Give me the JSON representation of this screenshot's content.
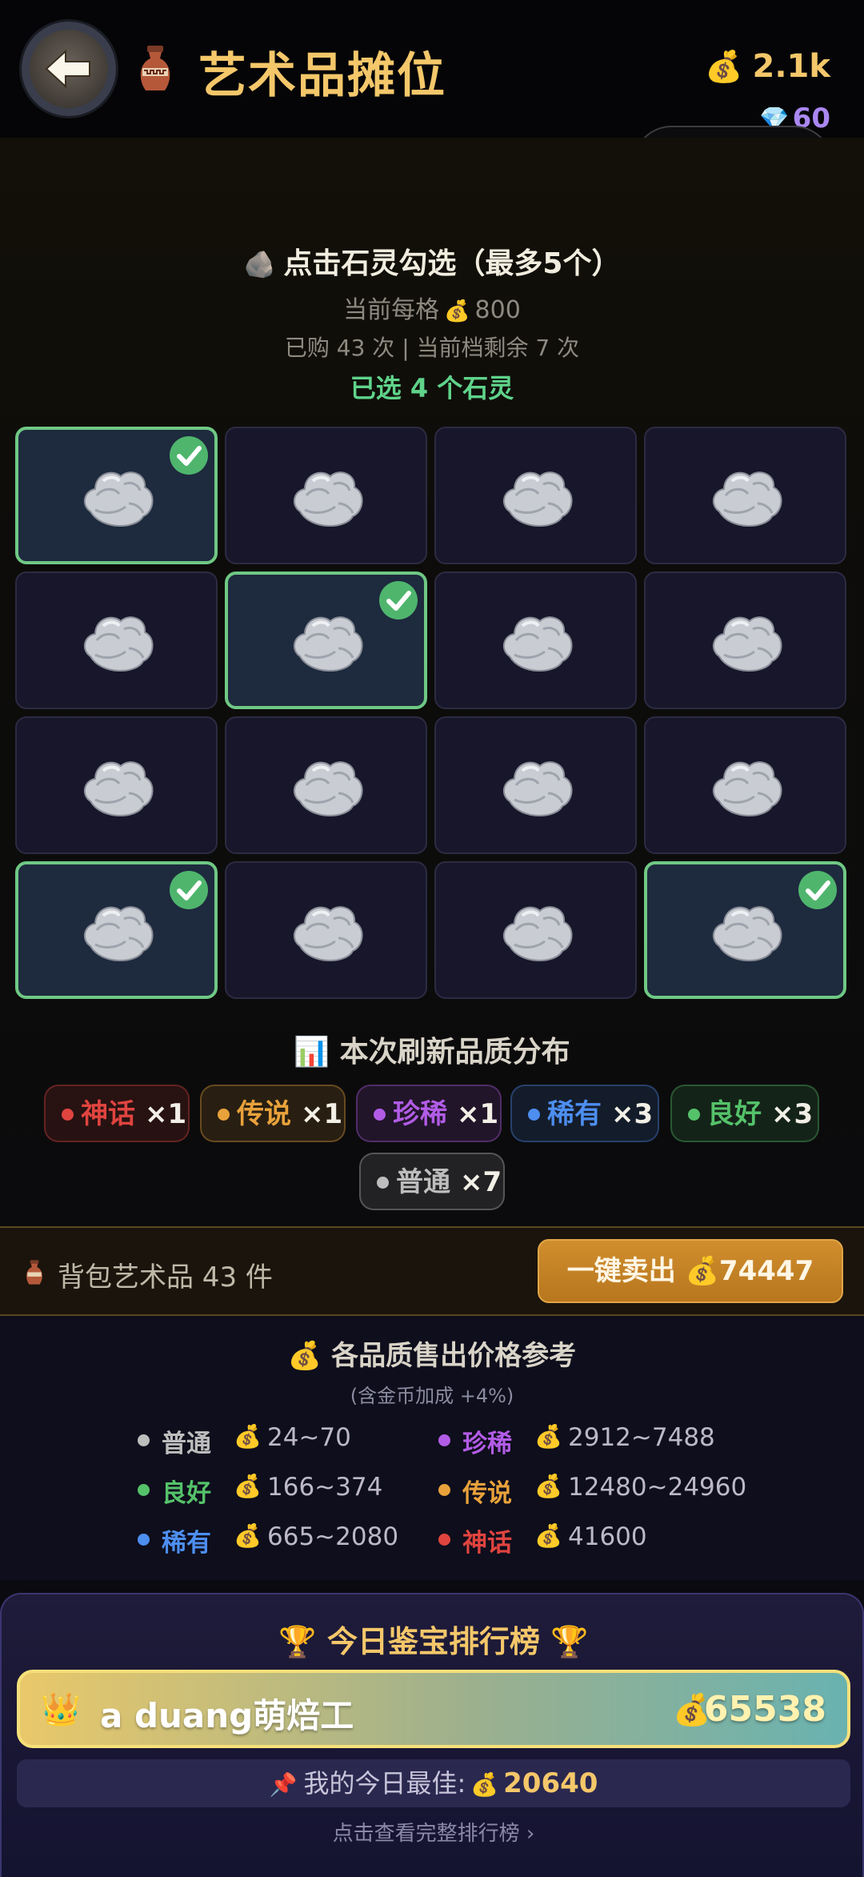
{
  "header": {
    "title": "艺术品摊位",
    "coins": "2.1k",
    "gems": "60"
  },
  "selection": {
    "instruction": "点击石灵勾选（最多5个）",
    "price_prefix": "当前每格",
    "price": "800",
    "purchase_info": "已购 43 次 | 当前档剩余 7 次",
    "selected_text": "已选 4 个石灵"
  },
  "grid": [
    {
      "selected": true
    },
    {
      "selected": false
    },
    {
      "selected": false
    },
    {
      "selected": false
    },
    {
      "selected": false
    },
    {
      "selected": true
    },
    {
      "selected": false
    },
    {
      "selected": false
    },
    {
      "selected": false
    },
    {
      "selected": false
    },
    {
      "selected": false
    },
    {
      "selected": false
    },
    {
      "selected": true
    },
    {
      "selected": false
    },
    {
      "selected": false
    },
    {
      "selected": true
    }
  ],
  "distribution": {
    "title": "本次刷新品质分布",
    "items": [
      {
        "name": "神话",
        "count": "×1",
        "color": "#e0443f"
      },
      {
        "name": "传说",
        "count": "×1",
        "color": "#e9a23b"
      },
      {
        "name": "珍稀",
        "count": "×1",
        "color": "#b25ce6"
      },
      {
        "name": "稀有",
        "count": "×3",
        "color": "#4d8ef0"
      },
      {
        "name": "良好",
        "count": "×3",
        "color": "#55c26a"
      },
      {
        "name": "普通",
        "count": "×7",
        "color": "#bdbdbd"
      }
    ]
  },
  "sellbar": {
    "label": "背包艺术品 43 件",
    "button": "一键卖出 💰74447"
  },
  "price_reference": {
    "title": "各品质售出价格参考",
    "subtitle": "(含金币加成 +4%)",
    "items": [
      {
        "name": "普通",
        "range": "24~70",
        "color": "#bdbdbd"
      },
      {
        "name": "珍稀",
        "range": "2912~7488",
        "color": "#b25ce6"
      },
      {
        "name": "良好",
        "range": "166~374",
        "color": "#55c26a"
      },
      {
        "name": "传说",
        "range": "12480~24960",
        "color": "#e9a23b"
      },
      {
        "name": "稀有",
        "range": "665~2080",
        "color": "#4d8ef0"
      },
      {
        "name": "神话",
        "range": "41600",
        "color": "#e0443f"
      }
    ]
  },
  "leaderboard": {
    "title": "今日鉴宝排行榜",
    "top_name": "a duang萌焙工",
    "top_score": "65538",
    "my_best_label": "我的今日最佳:",
    "my_best_value": "20640",
    "view_all": "点击查看完整排行榜 ›"
  }
}
